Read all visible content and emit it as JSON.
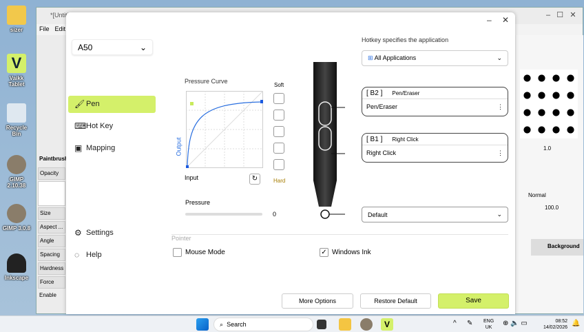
{
  "desktop": {
    "icons": [
      {
        "label": "sizer"
      },
      {
        "label": "Vaikk Tablet"
      },
      {
        "label": "Recycle Bin"
      },
      {
        "label": "GIMP 2.10.38"
      },
      {
        "label": "GIMP 3.0.8"
      },
      {
        "label": "Inkscape"
      }
    ]
  },
  "gimp": {
    "title": "*[Untitled]",
    "menu": [
      "File",
      "Edit"
    ],
    "tool_options": [
      "Paintbrush",
      "Opacity",
      "Size",
      "Aspect ...",
      "Angle",
      "Spacing",
      "Hardness",
      "Force",
      "Enable"
    ],
    "brush_size": "1.0",
    "mode": "Normal",
    "opacity": "100.0",
    "layer": "Background"
  },
  "dialog": {
    "device": "A50",
    "nav": [
      {
        "label": "Pen"
      },
      {
        "label": "Hot Key"
      },
      {
        "label": "Mapping"
      },
      {
        "label": "Settings"
      },
      {
        "label": "Help"
      }
    ],
    "curve": {
      "title": "Pressure Curve",
      "soft": "Soft",
      "hard": "Hard",
      "output": "Output",
      "input": "Input"
    },
    "pressure": {
      "label": "Pressure",
      "value": "0",
      "fraction": 0
    },
    "pointer": {
      "label": "Pointer",
      "mouse_mode": "Mouse Mode",
      "mouse_mode_checked": false,
      "windows_ink": "Windows Ink",
      "windows_ink_checked": true
    },
    "hotkey_label": "Hotkey specifies the application",
    "app_select": "All Applications",
    "buttons": [
      {
        "key": "[ B2 ]",
        "name": "Pen/Eraser",
        "value": "Pen/Eraser"
      },
      {
        "key": "[ B1 ]",
        "name": "Right Click",
        "value": "Right Click"
      }
    ],
    "tip": "Default",
    "more": "More Options",
    "restore": "Restore Default",
    "save": "Save",
    "accent": "#d4f06a"
  },
  "taskbar": {
    "search": "Search",
    "lang1": "ENG",
    "lang2": "UK",
    "time": "08:52",
    "date": "14/02/2026"
  }
}
